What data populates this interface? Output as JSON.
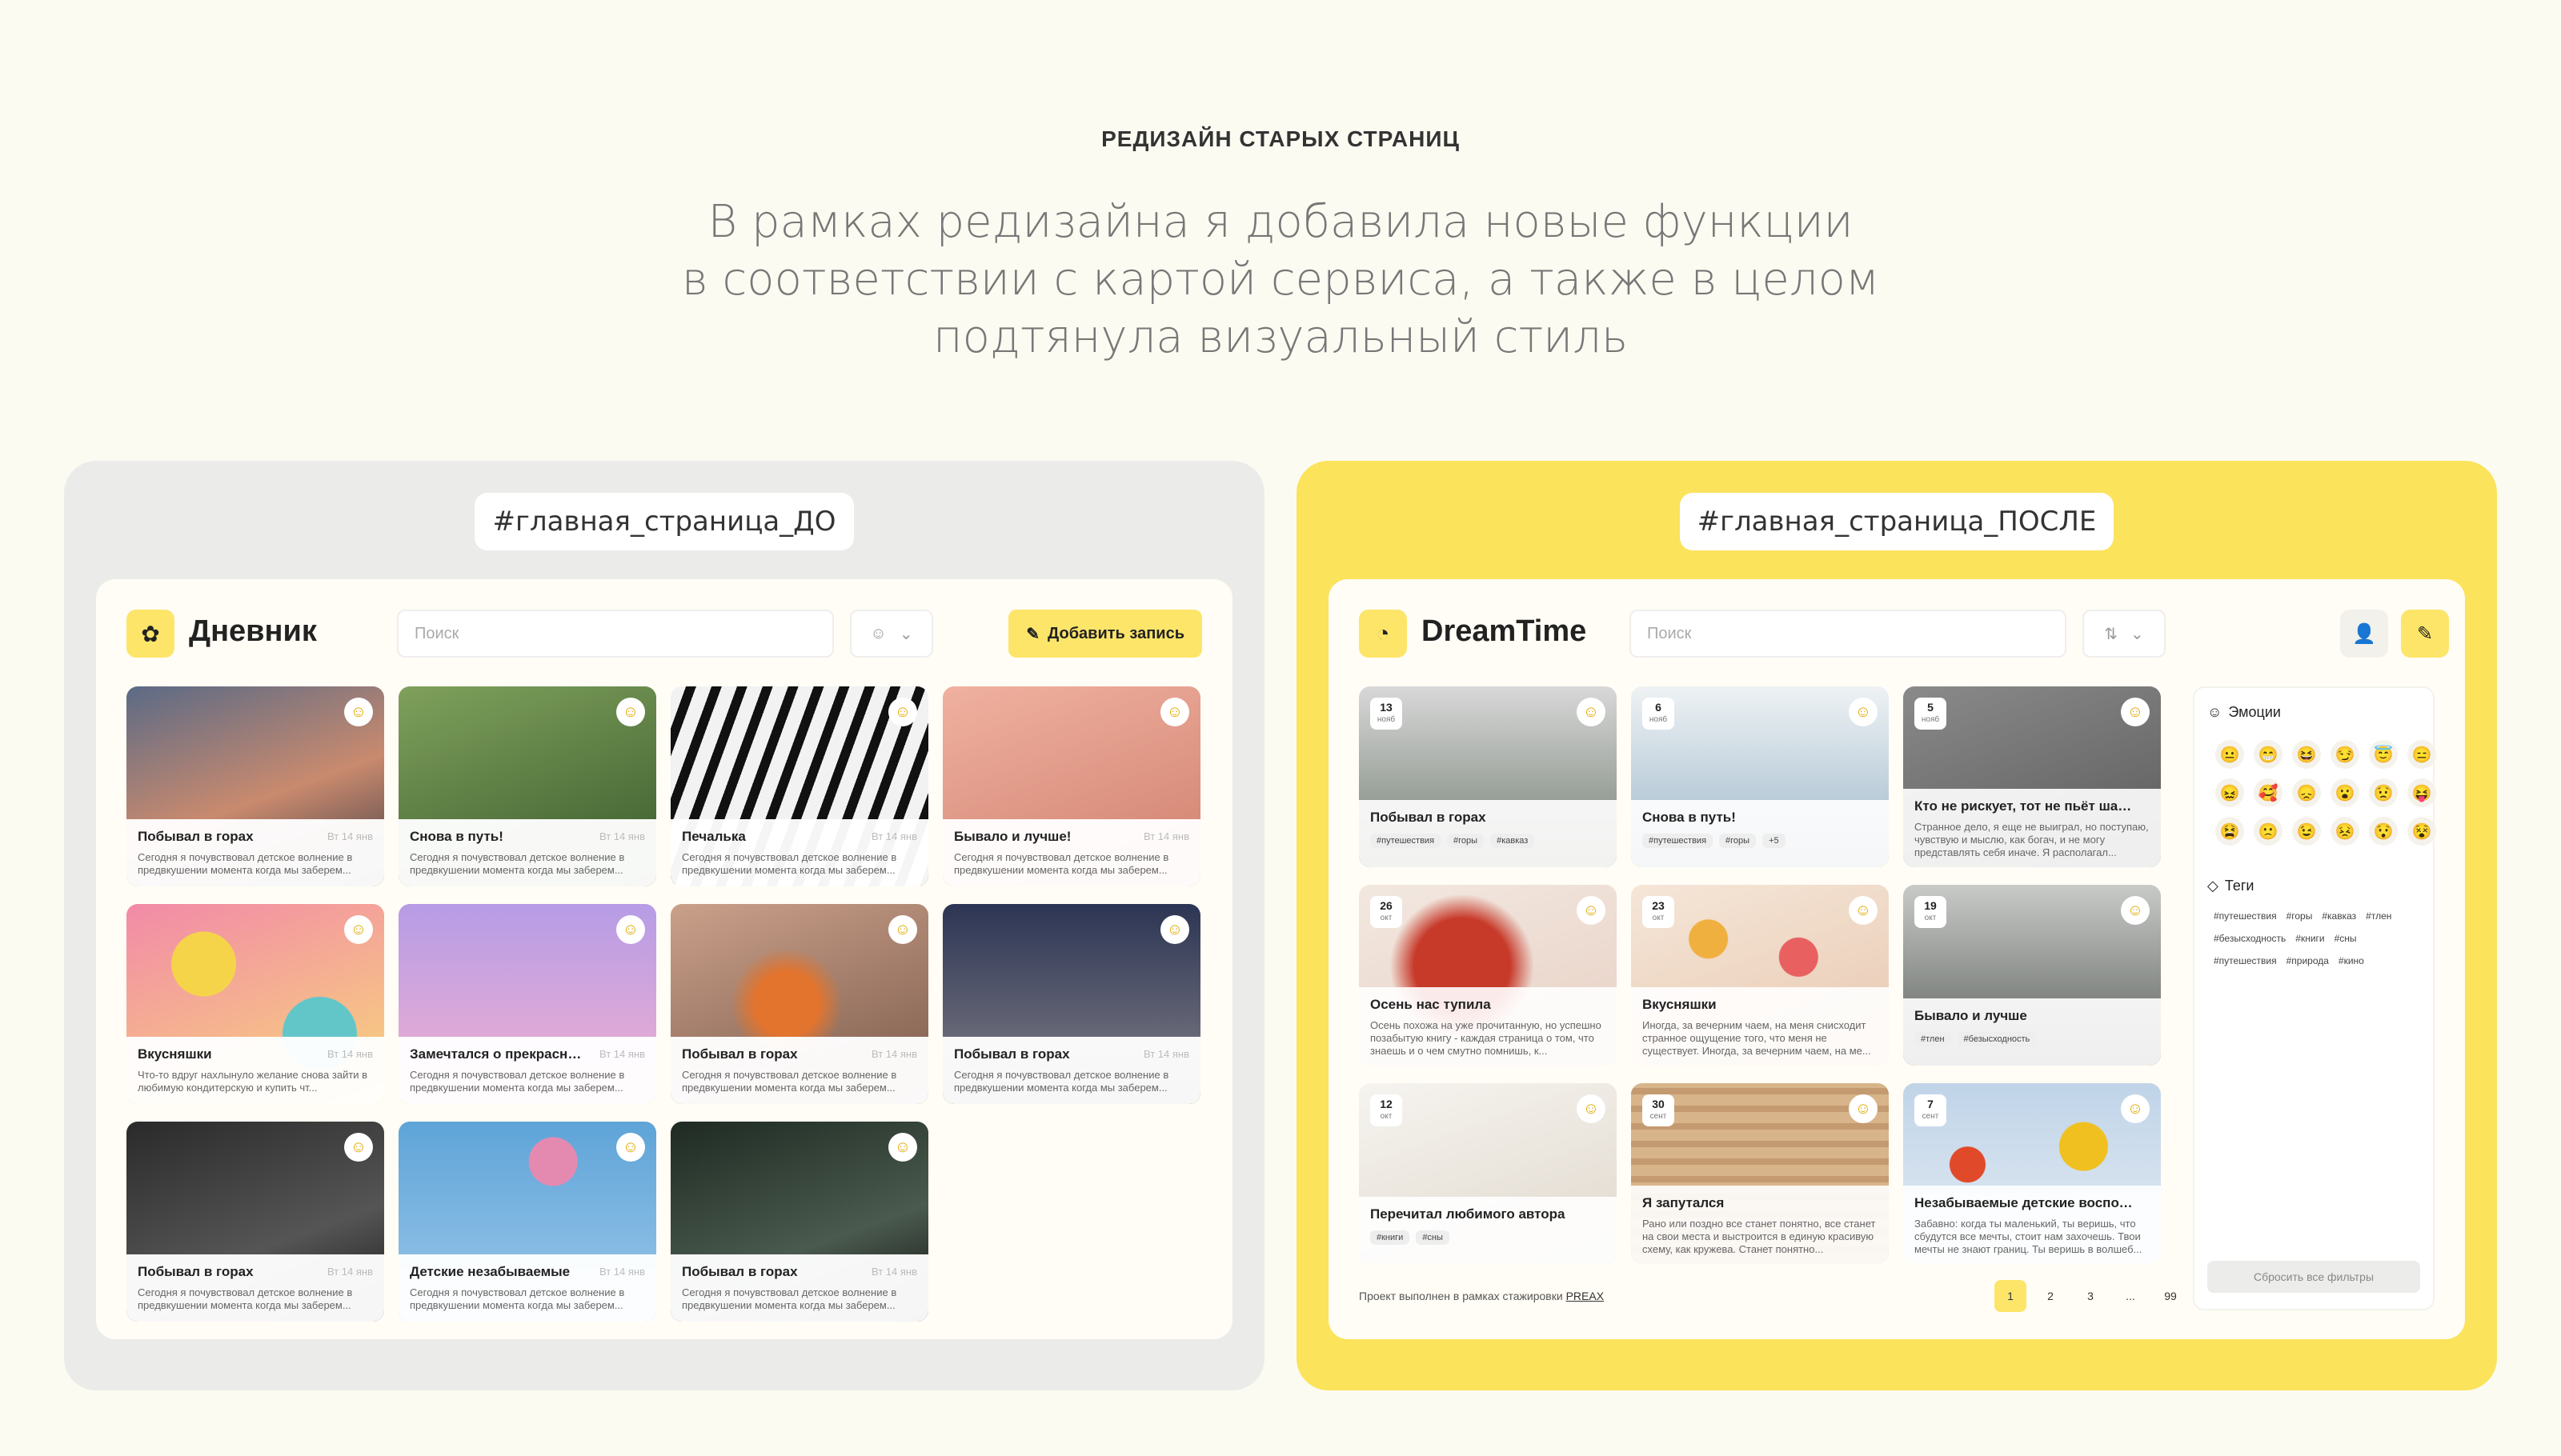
{
  "header": {
    "label": "РЕДИЗАЙН СТАРЫХ СТРАНИЦ",
    "lead": [
      "В рамках редизайна я добавила новые функции",
      "в соответствии с картой сервиса, а также в целом",
      "подтянула визуальный стиль"
    ]
  },
  "before": {
    "hashtag": "#главная_страница_ДО",
    "brand": "Дневник",
    "search_placeholder": "Поиск",
    "add_label": "Добавить запись",
    "date": "Вт 14 янв",
    "cards": [
      {
        "title": "Побывал в горах",
        "text": "Сегодня я почувствовал детское волнение в предвкушении момента когда мы заберем...",
        "bg": "linear-gradient(160deg,#5a6a86,#c98a6e 55%,#3d3a44)"
      },
      {
        "title": "Снова в путь!",
        "text": "Сегодня я почувствовал детское волнение в предвкушении момента когда мы заберем...",
        "bg": "linear-gradient(160deg,#7fa15c,#3a5a2c)"
      },
      {
        "title": "Печалька",
        "text": "Сегодня я почувствовал детское волнение в предвкушении момента когда мы заберем...",
        "bg": "repeating-linear-gradient(110deg,#f2f2f2 0 18px,#111 18px 30px)"
      },
      {
        "title": "Бывало и лучше!",
        "text": "Сегодня я почувствовал детское волнение в предвкушении момента когда мы заберем...",
        "bg": "linear-gradient(160deg,#f0b1a0,#d0806e)"
      },
      {
        "title": "Вкусняшки",
        "text": "Что-то вдруг нахлынуло желание снова зайти в любимую кондитерскую и купить чт...",
        "bg": "radial-gradient(circle at 30% 30%,#f5d44a 0 40px,transparent 41px),radial-gradient(circle at 75% 65%,#62c6c9 0 46px,transparent 47px),linear-gradient(160deg,#f28aa8,#f8d77a)"
      },
      {
        "title": "Замечтался о прекрасном",
        "text": "Сегодня я почувствовал детское волнение в предвкушении момента когда мы заберем...",
        "bg": "linear-gradient(180deg,#b69ce6,#f4b0d0)"
      },
      {
        "title": "Побывал в горах",
        "text": "Сегодня я почувствовал детское волнение в предвкушении момента когда мы заберем...",
        "bg": "radial-gradient(circle at 45% 50%,#e2742e 0 40px,transparent 70px),linear-gradient(160deg,#caa08a,#7a5a4a)"
      },
      {
        "title": "Побывал в горах",
        "text": "Сегодня я почувствовал детское волнение в предвкушении момента когда мы заберем...",
        "bg": "linear-gradient(180deg,#2c3554,#6a6a78 70%,#3a302c)"
      },
      {
        "title": "Побывал в горах",
        "text": "Сегодня я почувствовал детское волнение в предвкушении момента когда мы заберем...",
        "bg": "linear-gradient(160deg,#2a2a2a,#555 60%,#1a1a1a)"
      },
      {
        "title": "Детские незабываемые",
        "text": "Сегодня я почувствовал детское волнение в предвкушении момента когда мы заберем...",
        "bg": "radial-gradient(circle at 60% 20%,#e48ab0 0 30px,transparent 31px),linear-gradient(180deg,#5ea4d8,#9cc8ea)"
      },
      {
        "title": "Побывал в горах",
        "text": "Сегодня я почувствовал детское волнение в предвкушении момента когда мы заберем...",
        "bg": "linear-gradient(160deg,#1e2a22,#4a5a4e 60%,#111)"
      }
    ]
  },
  "after": {
    "hashtag": "#главная_страница_ПОСЛЕ",
    "brand": "DreamTime",
    "search_placeholder": "Поиск",
    "cards": [
      {
        "day": "13",
        "mon": "нояб",
        "title": "Побывал в горах",
        "text": "",
        "tags": [
          "#путешествия",
          "#горы",
          "#кавказ"
        ],
        "bg": "linear-gradient(180deg,#d8d8d8,#9aa19a 60%,#7a7a72)"
      },
      {
        "day": "6",
        "mon": "нояб",
        "title": "Снова в путь!",
        "text": "",
        "tags": [
          "#путешествия",
          "#горы",
          "+5"
        ],
        "bg": "linear-gradient(180deg,#eef2f4,#b4c8d6 70%,#92a8b8)"
      },
      {
        "day": "5",
        "mon": "нояб",
        "title": "Кто не рискует, тот не пьёт шампанское",
        "text": "Странное дело, я еще не выиграл, но поступаю, чувствую и мыслю, как богач, и не могу представлять себя иначе. Я располагал...",
        "tags": [],
        "bg": "linear-gradient(160deg,#8a8a8a,#5a5a5a)"
      },
      {
        "day": "26",
        "mon": "окт",
        "title": "Осень нас тупила",
        "text": "Осень похожа на уже прочитанную, но успешно позабытую книгу - каждая страница о том, что знаешь и о чем смутно помнишь, к...",
        "tags": [],
        "bg": "radial-gradient(circle at 40% 45%,#c73a2a 0 60px,transparent 90px),linear-gradient(160deg,#f2e8e0,#e8d0c4)"
      },
      {
        "day": "23",
        "mon": "окт",
        "title": "Вкусняшки",
        "text": "Иногда, за вечерним чаем, на меня снисходит странное ощущение того, что меня не существует. Иногда, за вечерним чаем, на ме...",
        "tags": [],
        "bg": "radial-gradient(circle at 30% 30%,#f0b040 0 24px,transparent 25px),radial-gradient(circle at 65% 40%,#e86060 0 24px,transparent 25px),linear-gradient(160deg,#f5e6d8,#e8c8b0)"
      },
      {
        "day": "19",
        "mon": "окт",
        "title": "Бывало и лучше",
        "text": "",
        "tags": [
          "#тлен",
          "#безысходность"
        ],
        "bg": "linear-gradient(180deg,#c8cac8,#7a7e7a 70%,#5a5e5a)"
      },
      {
        "day": "12",
        "mon": "окт",
        "title": "Перечитал любимого автора",
        "text": "",
        "tags": [
          "#книги",
          "#сны"
        ],
        "bg": "linear-gradient(160deg,#f6f4f0,#e0d8cc)"
      },
      {
        "day": "30",
        "mon": "сент",
        "title": "Я запутался",
        "text": "Рано или поздно все станет понятно, все станет на свои места и выстроится в единую красивую схему, как кружева. Станет понятно...",
        "tags": [],
        "bg": "repeating-linear-gradient(0deg,#d8b48a 0 14px,#c49a70 14px 22px)"
      },
      {
        "day": "7",
        "mon": "сент",
        "title": "Незабываемые детские воспоминания",
        "text": "Забавно: когда ты маленький, ты веришь, что сбудутся все мечты, стоит нам захочешь. Твои мечты не знают границ. Ты веришь в волшеб...",
        "tags": [],
        "bg": "radial-gradient(circle at 25% 45%,#e04a2a 0 22px,transparent 23px),radial-gradient(circle at 70% 35%,#f0c020 0 30px,transparent 31px),linear-gradient(180deg,#c0d4e8,#e4ecf4)"
      }
    ],
    "filters": {
      "emotions_title": "Эмоции",
      "emotions": [
        "😐",
        "😁",
        "😆",
        "😏",
        "😇",
        "😑",
        "😖",
        "🥰",
        "😞",
        "😮",
        "😟",
        "😝",
        "😫",
        "🙁",
        "😉",
        "😣",
        "😯",
        "😵"
      ],
      "tags_title": "Теги",
      "tags": [
        "#путешествия",
        "#горы",
        "#кавказ",
        "#тлен",
        "#безысходность",
        "#книги",
        "#сны",
        "#путешествия",
        "#природа",
        "#кино"
      ],
      "reset_label": "Сбросить все фильтры"
    },
    "footer": {
      "prefix": "Проект выполнен в рамках стажировки ",
      "link": "PREAX"
    },
    "pages": [
      "1",
      "2",
      "3",
      "...",
      "99"
    ]
  }
}
